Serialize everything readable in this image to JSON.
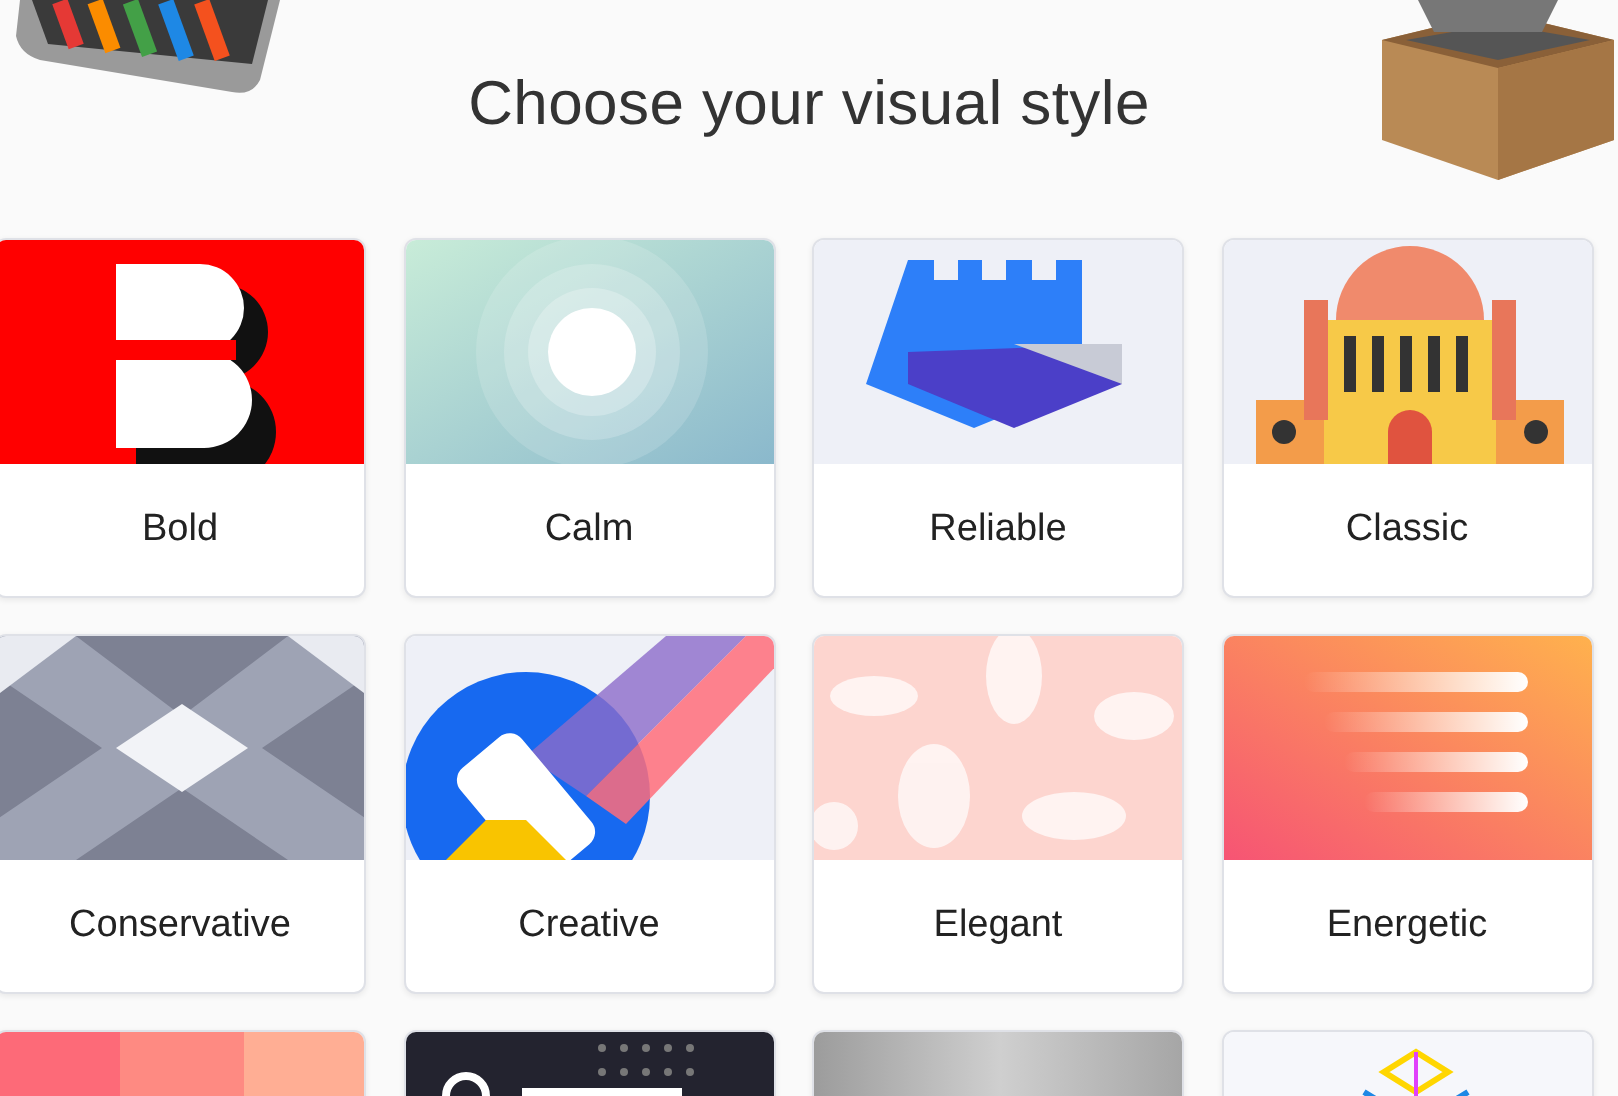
{
  "header": {
    "title": "Choose your visual style"
  },
  "cards": [
    {
      "kind": "letter",
      "label": "Bold"
    },
    {
      "kind": "rings",
      "label": "Calm"
    },
    {
      "kind": "castle",
      "label": "Reliable"
    },
    {
      "kind": "palace",
      "label": "Classic"
    },
    {
      "kind": "cubes",
      "label": "Conservative"
    },
    {
      "kind": "roller",
      "label": "Creative"
    },
    {
      "kind": "damask",
      "label": "Elegant"
    },
    {
      "kind": "streaks",
      "label": "Energetic"
    },
    {
      "kind": "stripes"
    },
    {
      "kind": "dots"
    },
    {
      "kind": "metal"
    },
    {
      "kind": "prism"
    }
  ]
}
